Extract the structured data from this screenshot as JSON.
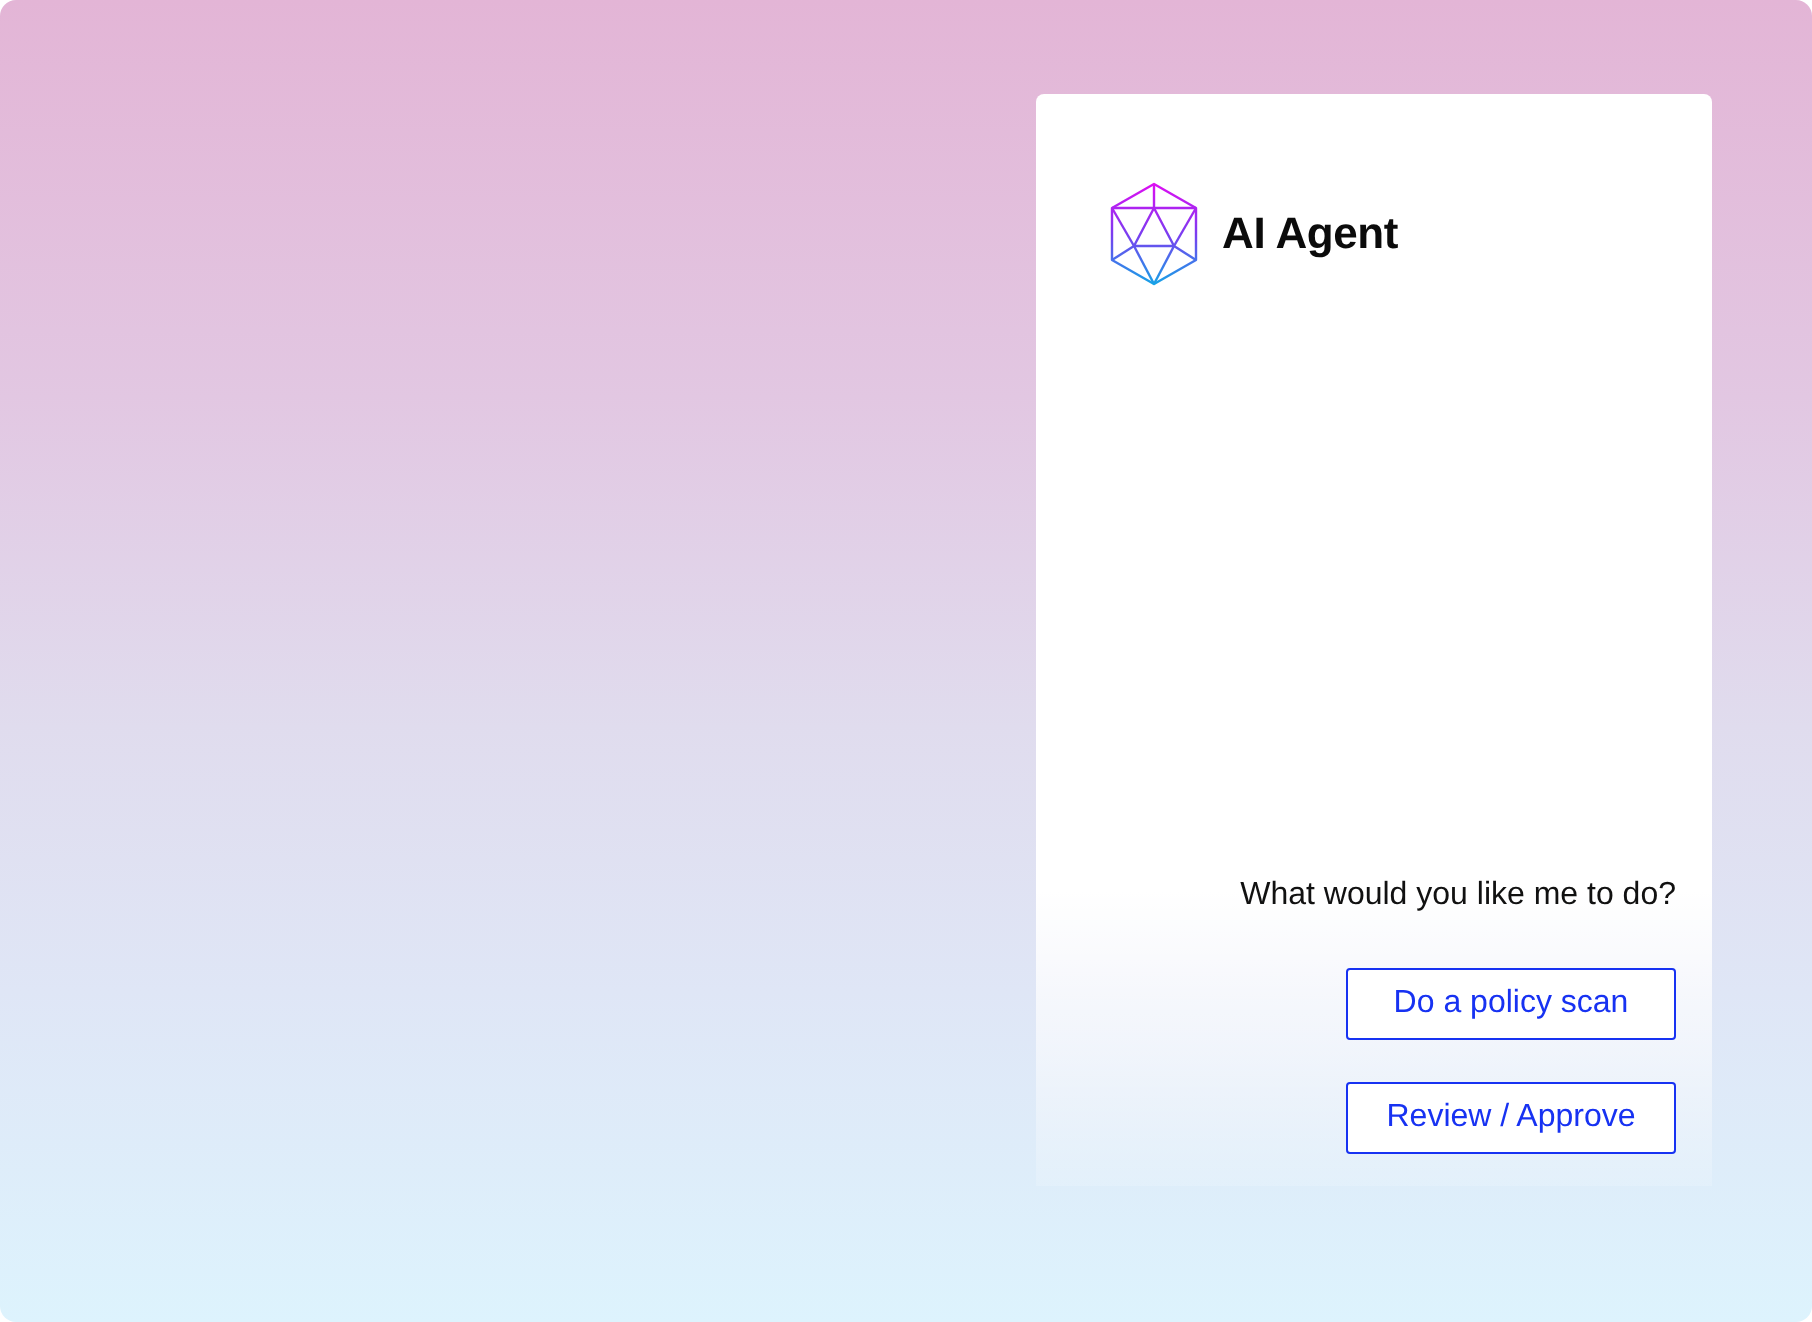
{
  "agent_panel": {
    "title": "AI Agent"
  },
  "chat": {
    "prompt": "What would you like me to do?",
    "actions": [
      {
        "label": "Do a policy scan"
      },
      {
        "label": "Review / Approve"
      }
    ]
  }
}
